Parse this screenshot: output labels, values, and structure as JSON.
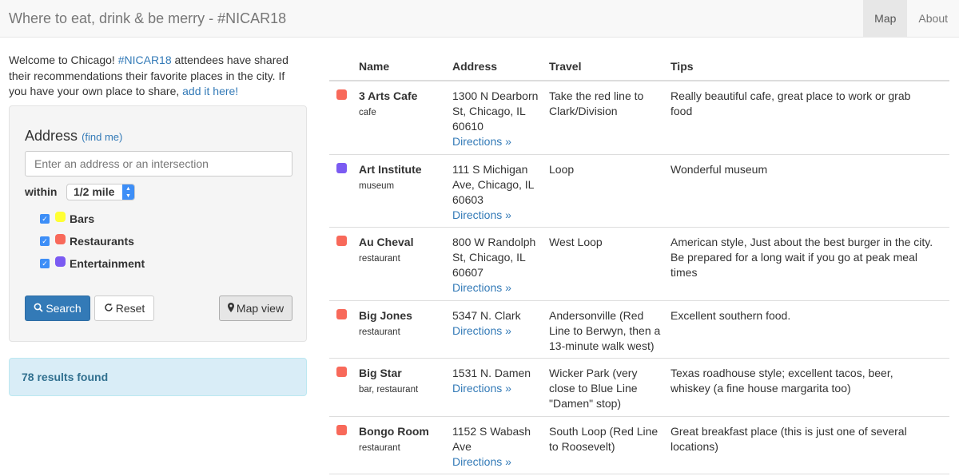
{
  "navbar": {
    "brand": "Where to eat, drink & be merry - #NICAR18",
    "items": [
      {
        "label": "Map",
        "active": true
      },
      {
        "label": "About",
        "active": false
      }
    ]
  },
  "intro": {
    "text_before": "Welcome to Chicago! ",
    "hashtag": "#NICAR18",
    "text_after": " attendees have shared their recommendations their favorite places in the city. If you have your own place to share, ",
    "link": "add it here!"
  },
  "search": {
    "address_label": "Address",
    "find_me": "(find me)",
    "placeholder": "Enter an address or an intersection",
    "within_label": "within",
    "radius": "1/2 mile",
    "layers": [
      {
        "label": "Bars",
        "checked": true,
        "color": "#ffff33"
      },
      {
        "label": "Restaurants",
        "checked": true,
        "color": "#f8695a"
      },
      {
        "label": "Entertainment",
        "checked": true,
        "color": "#7b5bf2"
      }
    ],
    "search_button": "Search",
    "reset_button": "Reset",
    "map_view_button": "Map view"
  },
  "results": {
    "text": "78 results found"
  },
  "table": {
    "headers": [
      "Name",
      "Address",
      "Travel",
      "Tips"
    ],
    "directions_label": "Directions »",
    "rows": [
      {
        "color": "#f8695a",
        "name": "3 Arts Cafe",
        "category": "cafe",
        "address": "1300 N Dearborn St, Chicago, IL 60610",
        "travel": "Take the red line to Clark/Division",
        "tips": "Really beautiful cafe, great place to work or grab food"
      },
      {
        "color": "#7b5bf2",
        "name": "Art Institute",
        "category": "museum",
        "address": "111 S Michigan Ave, Chicago, IL 60603",
        "travel": "Loop",
        "tips": "Wonderful museum"
      },
      {
        "color": "#f8695a",
        "name": "Au Cheval",
        "category": "restaurant",
        "address": "800 W Randolph St, Chicago, IL 60607",
        "travel": "West Loop",
        "tips": "American style, Just about the best burger in the city. Be prepared for a long wait if you go at peak meal times"
      },
      {
        "color": "#f8695a",
        "name": "Big Jones",
        "category": "restaurant",
        "address": "5347 N. Clark",
        "travel": "Andersonville (Red Line to Berwyn, then a 13-minute walk west)",
        "tips": "Excellent southern food."
      },
      {
        "color": "#f8695a",
        "name": "Big Star",
        "category": "bar, restaurant",
        "address": "1531 N. Damen",
        "travel": "Wicker Park (very close to Blue Line \"Damen\" stop)",
        "tips": "Texas roadhouse style; excellent tacos, beer, whiskey (a fine house margarita too)"
      },
      {
        "color": "#f8695a",
        "name": "Bongo Room",
        "category": "restaurant",
        "address": "1152 S Wabash Ave",
        "travel": "South Loop (Red Line to Roosevelt)",
        "tips": "Great breakfast place (this is just one of several locations)"
      }
    ]
  }
}
